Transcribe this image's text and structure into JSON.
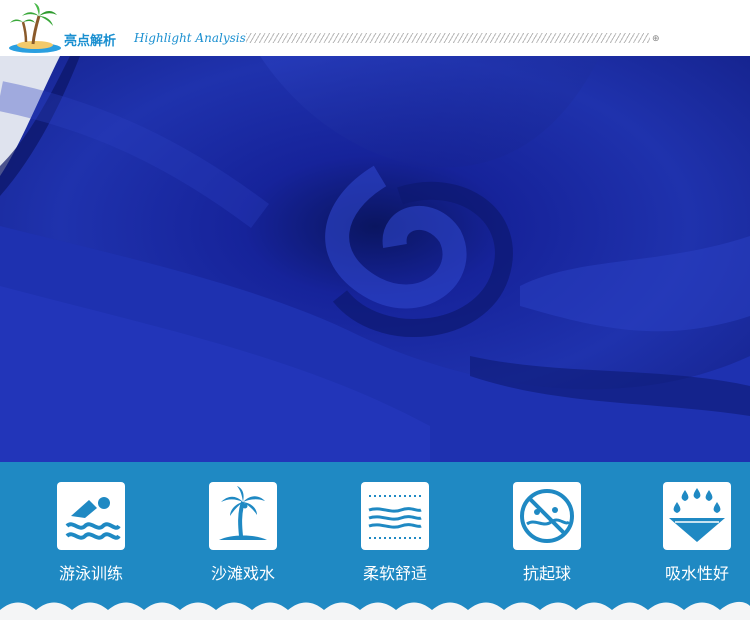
{
  "header": {
    "title": "亮点解析",
    "subtitle": "Highlight Analysis"
  },
  "features": [
    {
      "label": "游泳训练",
      "icon": "swimmer-icon"
    },
    {
      "label": "沙滩戏水",
      "icon": "palm-tree-island-icon"
    },
    {
      "label": "柔软舒适",
      "icon": "soft-fabric-icon"
    },
    {
      "label": "抗起球",
      "icon": "anti-pilling-icon"
    },
    {
      "label": "吸水性好",
      "icon": "water-absorption-icon"
    }
  ],
  "colors": {
    "accent": "#1a8fd0",
    "feature_band": "#1f89c3",
    "icon_fill": "#1f89c3",
    "fabric": "#1d2fa0"
  }
}
